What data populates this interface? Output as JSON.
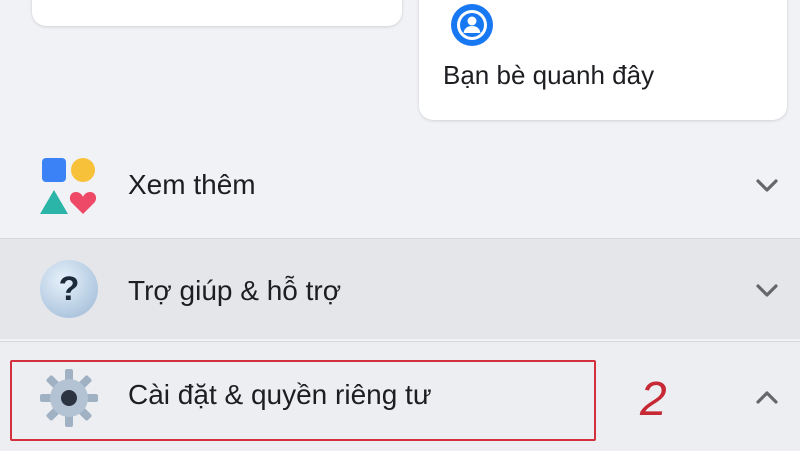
{
  "nearby_friends": {
    "label": "Bạn bè quanh đây",
    "icon": "nearby-friends-icon"
  },
  "menu": {
    "see_more": {
      "label": "Xem thêm",
      "icon": "shapes-icon",
      "expanded": false
    },
    "help_support": {
      "label": "Trợ giúp & hỗ trợ",
      "icon": "question-icon",
      "expanded": false
    },
    "settings_privacy": {
      "label": "Cài đặt & quyền riêng tư",
      "icon": "gear-icon",
      "expanded": true
    }
  },
  "annotation": {
    "step": "2",
    "color": "#d32f3c"
  },
  "colors": {
    "accent_blue": "#1877f2",
    "background": "#f0f2f5"
  }
}
